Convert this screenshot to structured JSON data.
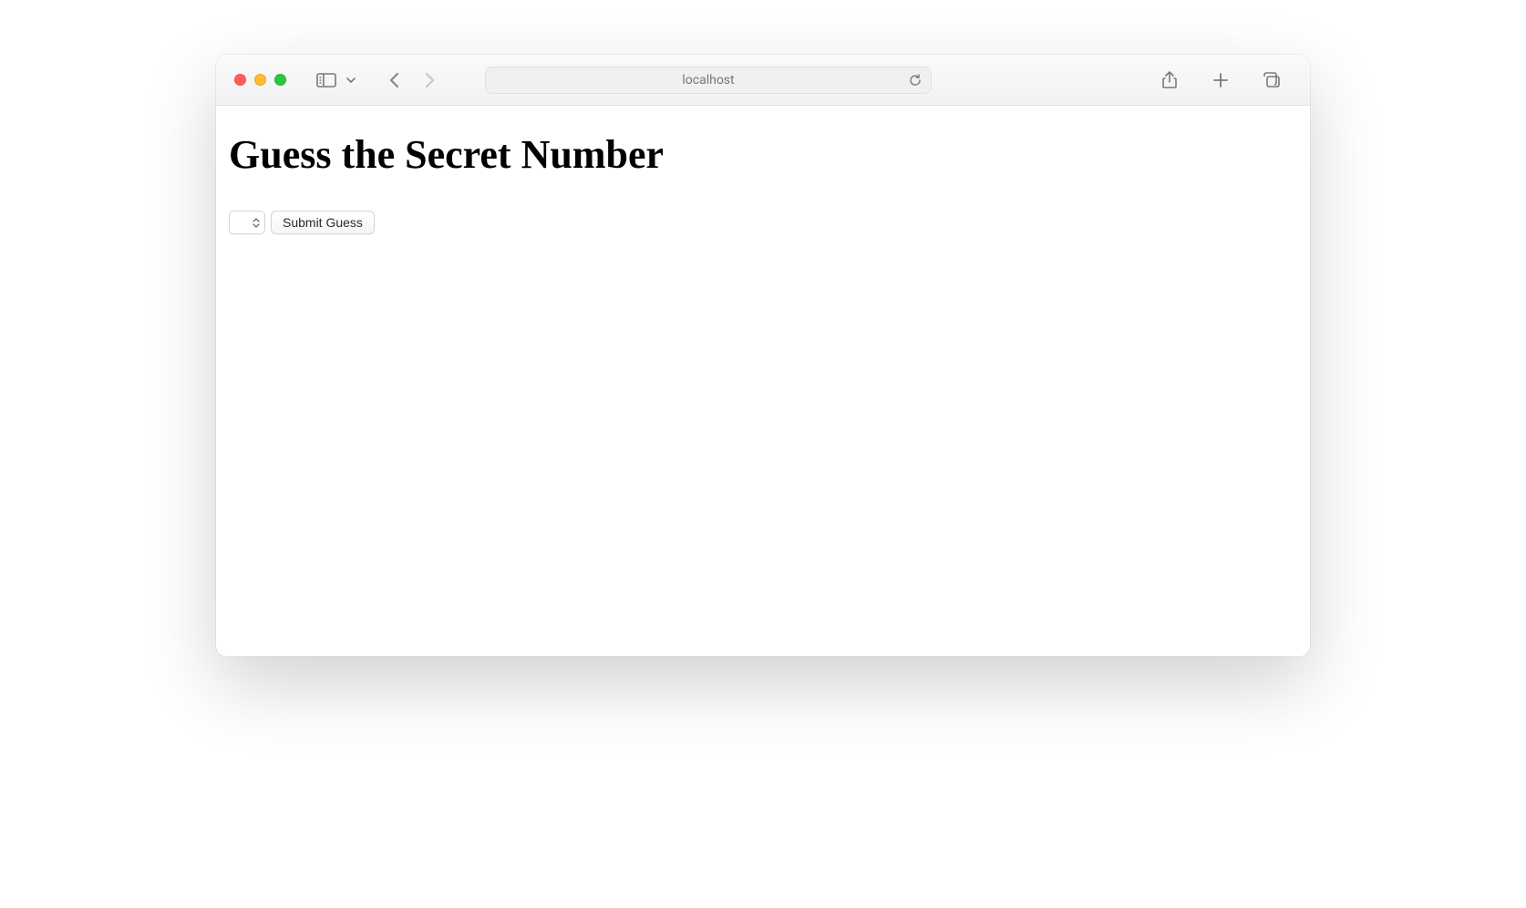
{
  "browser": {
    "address": "localhost"
  },
  "page": {
    "heading": "Guess the Secret Number",
    "form": {
      "guess_value": "",
      "submit_label": "Submit Guess"
    }
  }
}
